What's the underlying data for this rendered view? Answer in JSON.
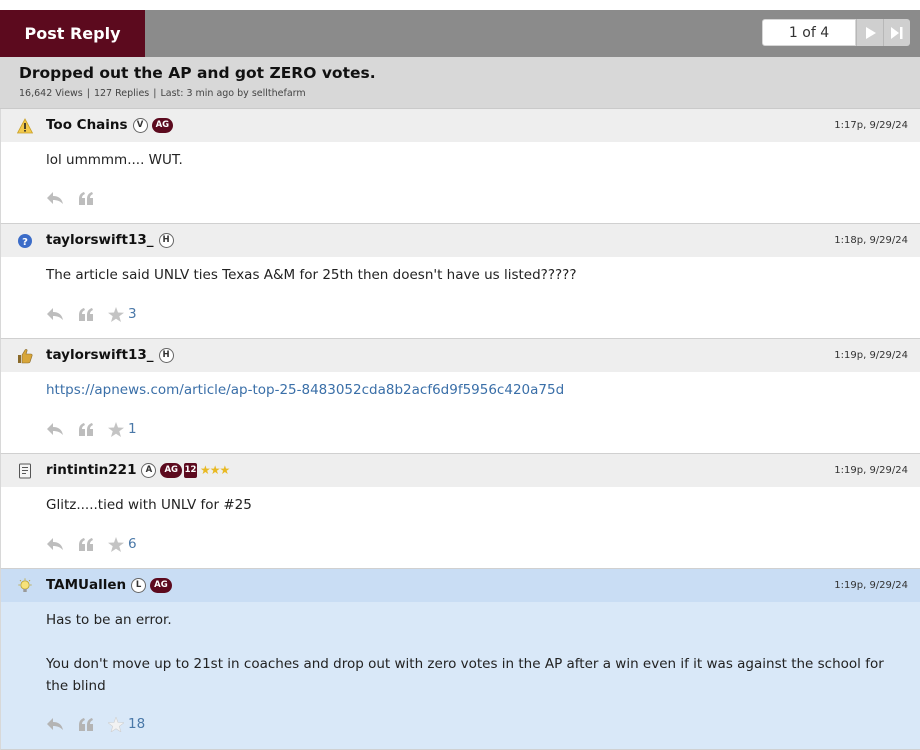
{
  "header": {
    "post_reply_label": "Post Reply",
    "pager": {
      "label": "1 of 4"
    }
  },
  "thread": {
    "title": "Dropped out the AP and got ZERO votes.",
    "views": "16,642 Views",
    "replies": "127 Replies",
    "last": "Last: 3 min ago by sellthefarm"
  },
  "posts": [
    {
      "user": "Too Chains",
      "badge1": "V",
      "badge_ag": "AG",
      "time": "1:17p, 9/29/24",
      "body": "lol ummmm.... WUT.",
      "stars": "",
      "icon": "warning-icon"
    },
    {
      "user": "taylorswift13_",
      "badge1": "H",
      "time": "1:18p, 9/29/24",
      "body": "The article said UNLV ties Texas A&M for 25th then doesn't have us listed?????",
      "stars": "3",
      "icon": "question-icon"
    },
    {
      "user": "taylorswift13_",
      "badge1": "H",
      "time": "1:19p, 9/29/24",
      "body": "https://apnews.com/article/ap-top-25-8483052cda8b2acf6d9f5956c420a75d",
      "stars": "1",
      "icon": "thumbs-up-icon"
    },
    {
      "user": "rintintin221",
      "badge1": "A",
      "badge_ag": "AG",
      "badge_12": "12",
      "rank_stars": "★★★",
      "time": "1:19p, 9/29/24",
      "body": "Glitz.....tied with UNLV for #25",
      "stars": "6",
      "icon": "document-icon"
    },
    {
      "user": "TAMUallen",
      "badge1": "L",
      "badge_ag": "AG",
      "time": "1:19p, 9/29/24",
      "body1": "Has to be an error.",
      "body2": "You don't move up to 21st in coaches and drop out with zero votes in the AP after a win even if it was against the school for the blind",
      "stars": "18",
      "icon": "lightbulb-icon"
    }
  ],
  "colors": {
    "maroon": "#5c0a1e",
    "link": "#3a6fa8",
    "highlight": "#d9e8f8"
  }
}
